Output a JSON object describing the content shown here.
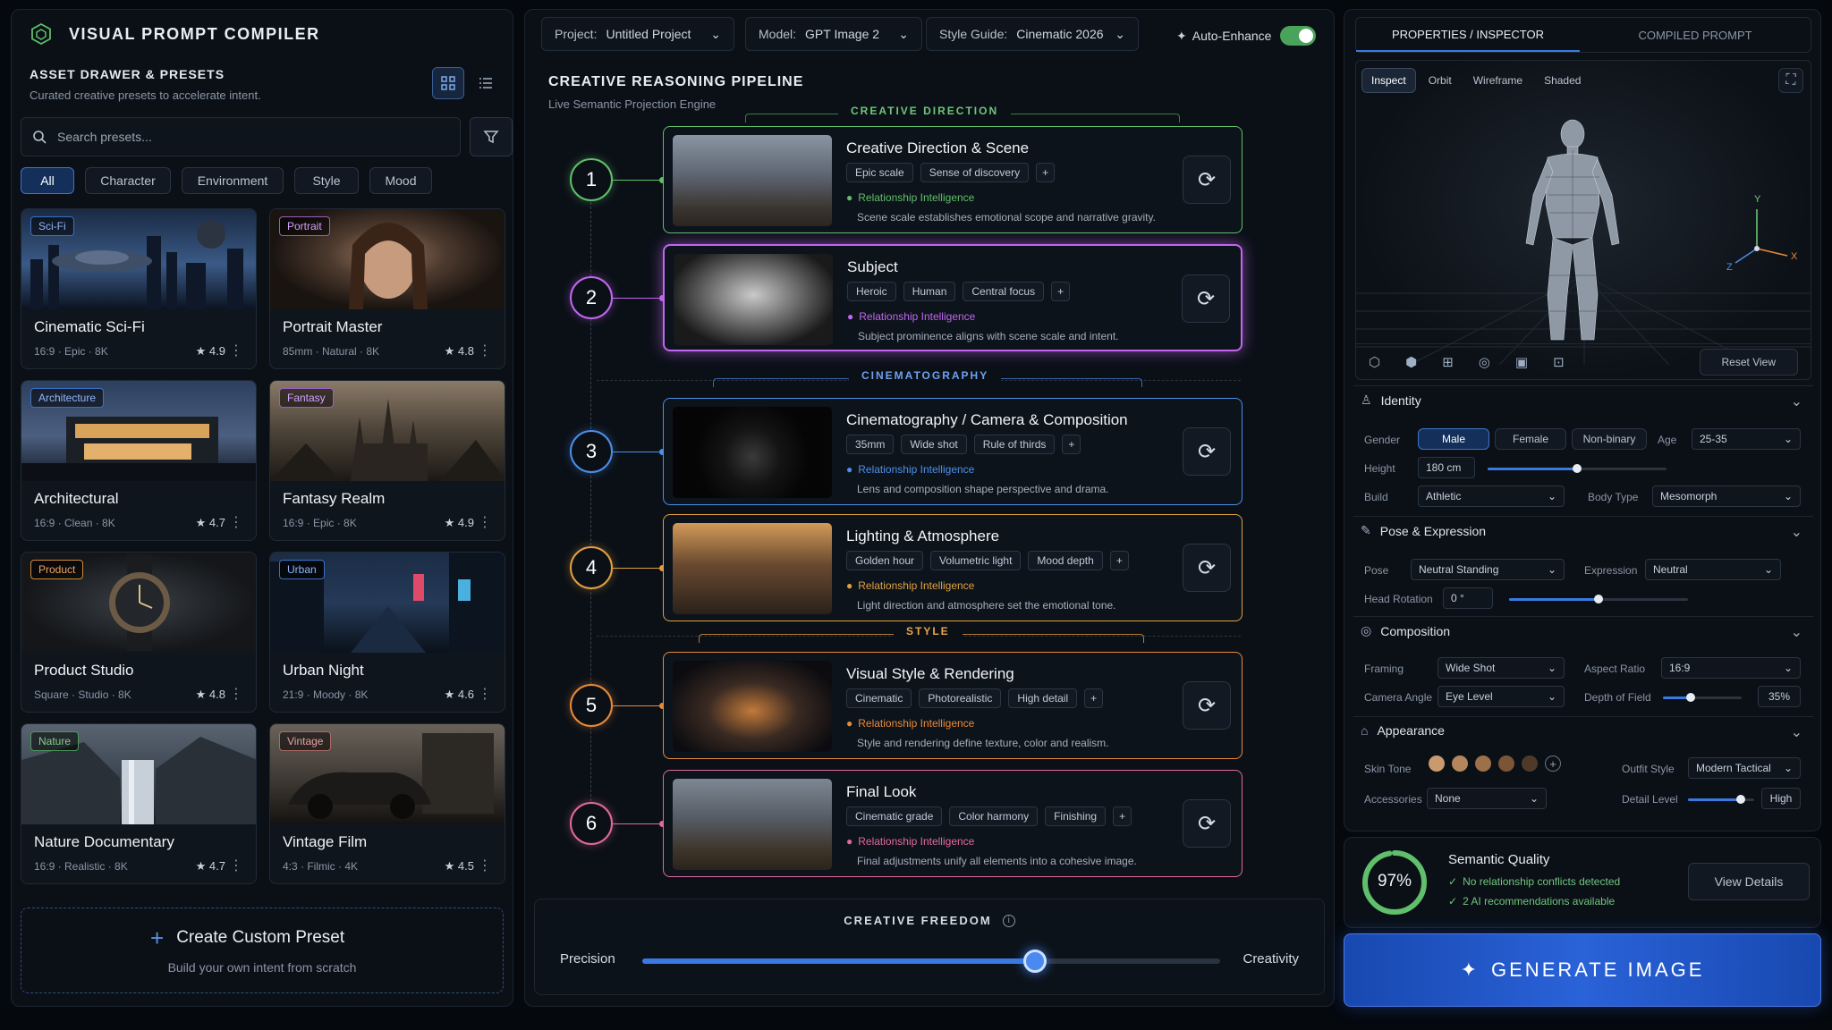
{
  "app": {
    "title": "VISUAL PROMPT COMPILER"
  },
  "drawer": {
    "title": "ASSET DRAWER & PRESETS",
    "subtitle": "Curated creative presets to accelerate intent.",
    "search_placeholder": "Search presets...",
    "filters": [
      "All",
      "Character",
      "Environment",
      "Style",
      "Mood"
    ],
    "presets": [
      {
        "badge": "Sci-Fi",
        "title": "Cinematic Sci-Fi",
        "meta": "16:9 · Epic · 8K",
        "rating": "★ 4.9",
        "color": "#6fa7ff"
      },
      {
        "badge": "Portrait",
        "title": "Portrait Master",
        "meta": "85mm · Natural · 8K",
        "rating": "★ 4.8",
        "color": "#d3a1ff"
      },
      {
        "badge": "Architecture",
        "title": "Architectural",
        "meta": "16:9 · Clean · 8K",
        "rating": "★ 4.7",
        "color": "#6fa7ff"
      },
      {
        "badge": "Fantasy",
        "title": "Fantasy Realm",
        "meta": "16:9 · Epic · 8K",
        "rating": "★ 4.9",
        "color": "#d3a1ff"
      },
      {
        "badge": "Product",
        "title": "Product Studio",
        "meta": "Square · Studio · 8K",
        "rating": "★ 4.8",
        "color": "#f0a35a"
      },
      {
        "badge": "Urban",
        "title": "Urban Night",
        "meta": "21:9 · Moody · 8K",
        "rating": "★ 4.6",
        "color": "#6fa7ff"
      },
      {
        "badge": "Nature",
        "title": "Nature Documentary",
        "meta": "16:9 · Realistic · 8K",
        "rating": "★ 4.7",
        "color": "#7fd08a"
      },
      {
        "badge": "Vintage",
        "title": "Vintage Film",
        "meta": "4:3 · Filmic · 4K",
        "rating": "★ 4.5",
        "color": "#e8a0a0"
      }
    ],
    "create": {
      "title": "Create Custom Preset",
      "subtitle": "Build your own intent from scratch"
    }
  },
  "toolbar": {
    "project_label": "Project:",
    "project_value": "Untitled Project",
    "model_label": "Model:",
    "model_value": "GPT Image 2",
    "style_label": "Style Guide:",
    "style_value": "Cinematic 2026",
    "auto_enhance": "Auto-Enhance"
  },
  "pipeline": {
    "title": "CREATIVE REASONING PIPELINE",
    "subtitle": "Live Semantic Projection Engine",
    "sections": {
      "direction": "CREATIVE DIRECTION",
      "cinema": "CINEMATOGRAPHY",
      "style": "STYLE"
    },
    "ri_label": "Relationship Intelligence",
    "steps": [
      {
        "num": "1",
        "title": "Creative Direction & Scene",
        "tags": [
          "Epic scale",
          "Sense of discovery"
        ],
        "desc": "Scene scale establishes emotional scope and narrative gravity.",
        "color": "#5fbf6a"
      },
      {
        "num": "2",
        "title": "Subject",
        "tags": [
          "Heroic",
          "Human",
          "Central focus"
        ],
        "desc": "Subject prominence aligns with scene scale and intent.",
        "color": "#c266f0"
      },
      {
        "num": "3",
        "title": "Cinematography / Camera & Composition",
        "tags": [
          "35mm",
          "Wide shot",
          "Rule of thirds"
        ],
        "desc": "Lens and composition shape perspective and drama.",
        "color": "#4b8fe8"
      },
      {
        "num": "4",
        "title": "Lighting & Atmosphere",
        "tags": [
          "Golden hour",
          "Volumetric light",
          "Mood depth"
        ],
        "desc": "Light direction and atmosphere set the emotional tone.",
        "color": "#e0a040"
      },
      {
        "num": "5",
        "title": "Visual Style & Rendering",
        "tags": [
          "Cinematic",
          "Photorealistic",
          "High detail"
        ],
        "desc": "Style and rendering define texture, color and realism.",
        "color": "#e88a3a"
      },
      {
        "num": "6",
        "title": "Final Look",
        "tags": [
          "Cinematic grade",
          "Color harmony",
          "Finishing"
        ],
        "desc": "Final adjustments unify all elements into a cohesive image.",
        "color": "#e06a9a"
      }
    ]
  },
  "freedom": {
    "title": "CREATIVE FREEDOM",
    "left": "Precision",
    "right": "Creativity",
    "value": 0.68
  },
  "inspector": {
    "tabs": [
      "PROPERTIES / INSPECTOR",
      "COMPILED PROMPT"
    ],
    "view_modes": [
      "Inspect",
      "Orbit",
      "Wireframe",
      "Shaded"
    ],
    "reset_view": "Reset View",
    "identity": {
      "title": "Identity",
      "gender_label": "Gender",
      "genders": [
        "Male",
        "Female",
        "Non-binary"
      ],
      "age_label": "Age",
      "age": "25-35",
      "height_label": "Height",
      "height": "180 cm",
      "height_level": 0.5,
      "build_label": "Build",
      "build": "Athletic",
      "body_label": "Body Type",
      "body": "Mesomorph"
    },
    "pose": {
      "title": "Pose & Expression",
      "pose_label": "Pose",
      "pose": "Neutral Standing",
      "expr_label": "Expression",
      "expr": "Neutral",
      "rot_label": "Head Rotation",
      "rot": "0 °",
      "rot_level": 0.5
    },
    "composition": {
      "title": "Composition",
      "framing_label": "Framing",
      "framing": "Wide Shot",
      "aspect_label": "Aspect Ratio",
      "aspect": "16:9",
      "angle_label": "Camera Angle",
      "angle": "Eye Level",
      "dof_label": "Depth of Field",
      "dof": "35%",
      "dof_level": 0.35
    },
    "appearance": {
      "title": "Appearance",
      "skin_label": "Skin Tone",
      "skin_tones": [
        "#c99a6e",
        "#b5865c",
        "#9c7048",
        "#7a5536",
        "#4f3a2a"
      ],
      "outfit_label": "Outfit Style",
      "outfit": "Modern Tactical",
      "acc_label": "Accessories",
      "acc": "None",
      "detail_label": "Detail Level",
      "detail": "High",
      "detail_level": 0.8
    }
  },
  "quality": {
    "percent": "97%",
    "value": 0.97,
    "title": "Semantic Quality",
    "line1": "No relationship conflicts detected",
    "line2": "2 AI recommendations available",
    "button": "View Details"
  },
  "generate": {
    "label": "GENERATE IMAGE"
  }
}
